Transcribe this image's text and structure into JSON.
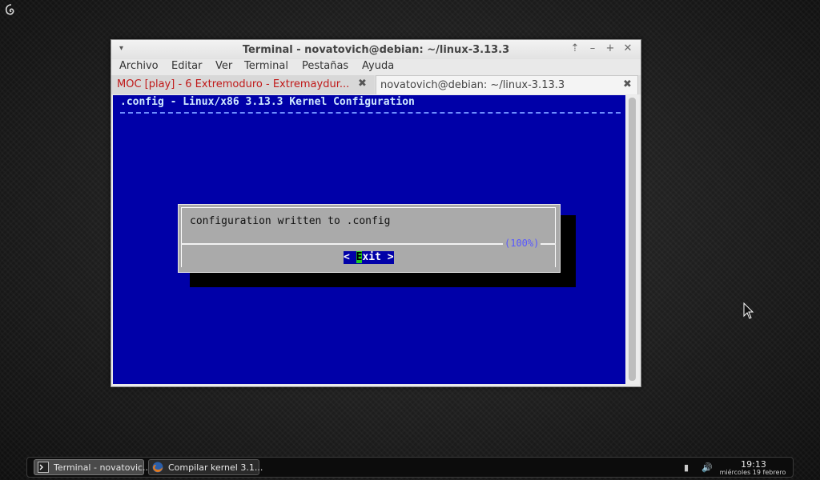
{
  "window": {
    "title": "Terminal - novatovich@debian: ~/linux-3.13.3",
    "controls": {
      "menu": "▾",
      "up": "⇡",
      "minimize": "–",
      "maximize": "+",
      "close": "✕"
    }
  },
  "menubar": [
    "Archivo",
    "Editar",
    "Ver",
    "Terminal",
    "Pestañas",
    "Ayuda"
  ],
  "tabs": [
    {
      "label": "MOC [play] - 6 Extremoduro - Extremaydur...",
      "close": "✖"
    },
    {
      "label": "novatovich@debian: ~/linux-3.13.3",
      "close": "✖"
    }
  ],
  "terminal": {
    "header": ".config - Linux/x86 3.13.3 Kernel Configuration",
    "bg_color": "#0000a8",
    "dialog": {
      "message": "configuration written to .config",
      "percent": "(100%)",
      "exit_left": "< ",
      "exit_hotkey": "E",
      "exit_rest": "xit >"
    }
  },
  "taskbar": {
    "tasks": [
      {
        "label": "Terminal - novatovic...",
        "icon": "terminal-icon"
      },
      {
        "label": "Compilar kernel 3.1...",
        "icon": "firefox-icon"
      }
    ],
    "tray": {
      "network": "▮",
      "volume": "🔊"
    },
    "clock": {
      "time": "19:13",
      "date": "miércoles 19 febrero"
    }
  }
}
